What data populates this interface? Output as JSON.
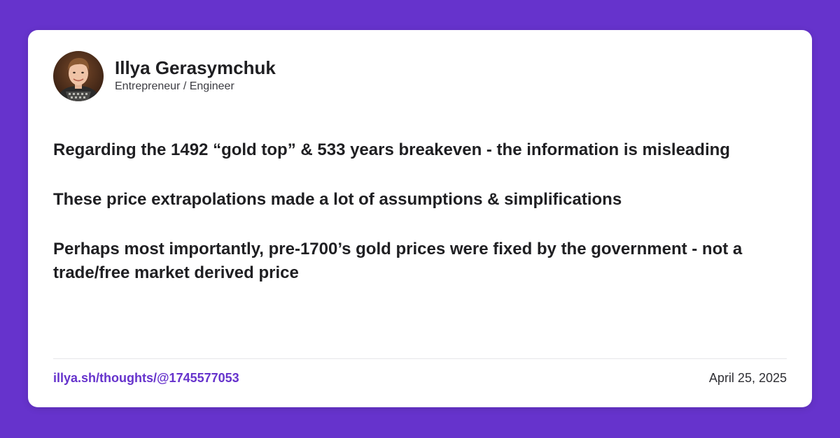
{
  "colors": {
    "background": "#6633cc",
    "card": "#ffffff",
    "text": "#1f1f22",
    "link": "#6633cc"
  },
  "author": {
    "name": "Illya Gerasymchuk",
    "role": "Entrepreneur / Engineer",
    "avatar_icon": "profile-photo"
  },
  "post": {
    "paragraphs": [
      "Regarding the 1492 “gold top” & 533 years breakeven - the information is misleading",
      "These price extrapolations made a lot of assumptions & simplifications",
      "Perhaps most importantly, pre-1700’s gold prices were fixed by the government - not a trade/free market derived price"
    ]
  },
  "footer": {
    "link_text": "illya.sh/thoughts/@1745577053",
    "date": "April 25, 2025"
  }
}
